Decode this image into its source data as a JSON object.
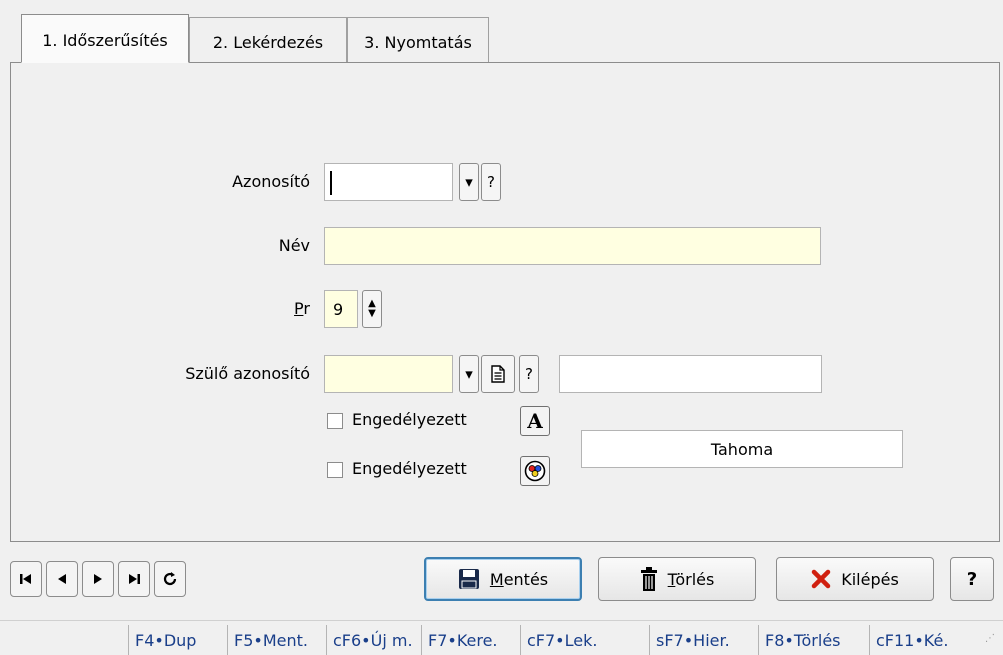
{
  "tabs": [
    {
      "label": "1. Időszerűsítés",
      "active": true
    },
    {
      "label": "2. Lekérdezés",
      "active": false
    },
    {
      "label": "3. Nyomtatás",
      "active": false
    }
  ],
  "form": {
    "azonosito_label": "Azonosító",
    "azonosito_value": "",
    "dropdown_icon": "▾",
    "help_glyph": "?",
    "nev_label": "Név",
    "nev_value": "",
    "pr_label_underlined": "P",
    "pr_label_rest": "r",
    "pr_value": "9",
    "szulo_label": "Szülő azonosító",
    "szulo_value": "",
    "szulo_name_value": "",
    "engedelyezett1_label": "Engedélyezett",
    "engedelyezett1_checked": false,
    "engedelyezett2_label": "Engedélyezett",
    "engedelyezett2_checked": false,
    "font_display": "Tahoma"
  },
  "toolbar": {
    "save_underlined": "M",
    "save_rest": "entés",
    "delete_underlined": "T",
    "delete_rest": "örlés",
    "exit_label": "Kilépés",
    "help_label": "?"
  },
  "statusbar": [
    "F4•Dup",
    "F5•Ment.",
    "cF6•Új m.",
    "F7•Kere.",
    "cF7•Lek.",
    "sF7•Hier.",
    "F8•Törlés",
    "cF11•Ké."
  ],
  "colors": {
    "required_field_bg": "#ffffe1",
    "statusbar_text": "#1a3f8a",
    "exit_icon": "#d02010"
  }
}
